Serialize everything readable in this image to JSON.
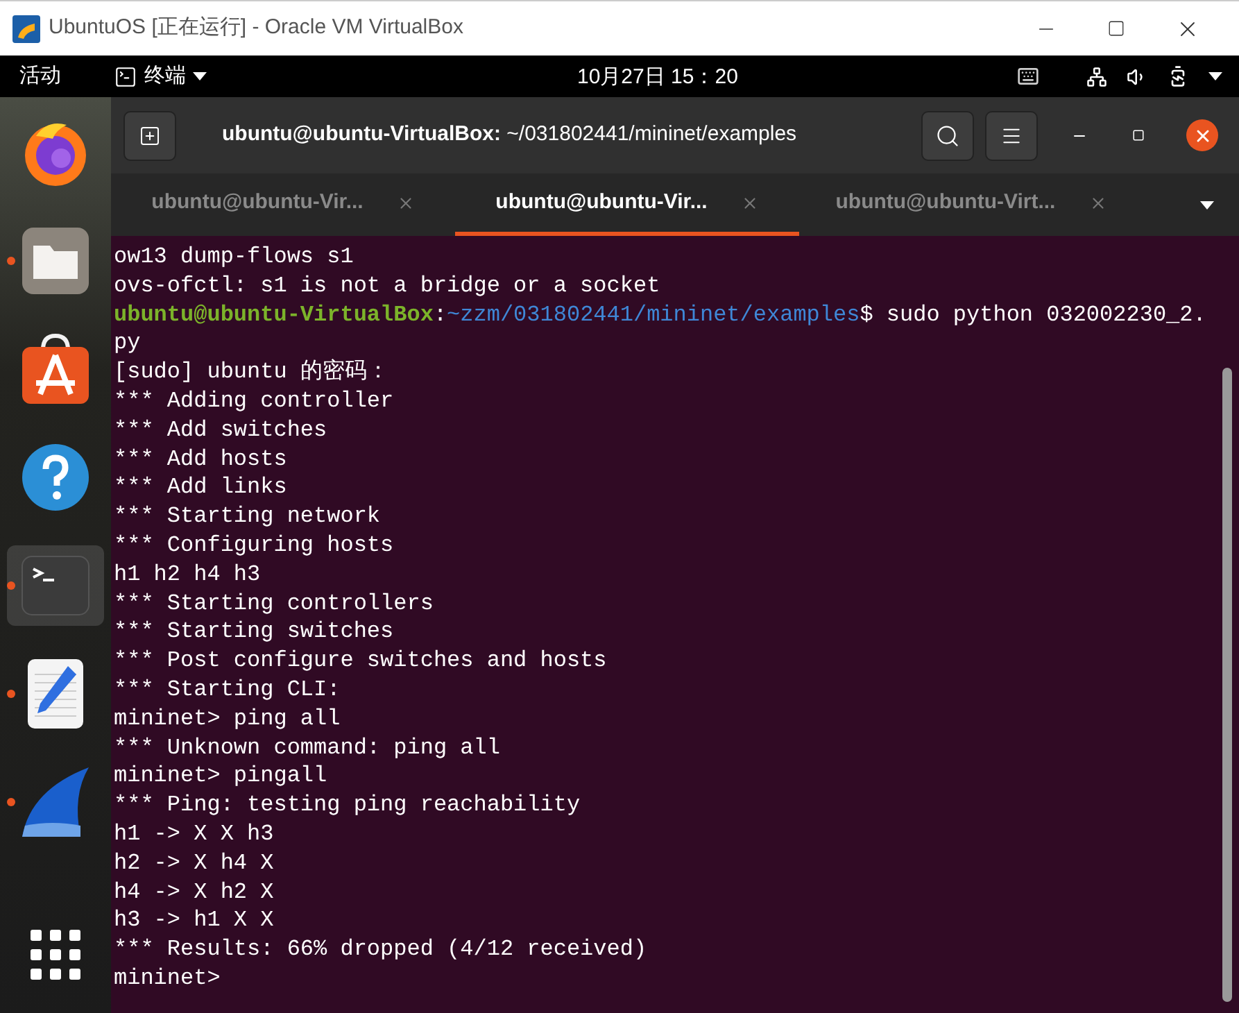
{
  "window": {
    "title": "UbuntuOS [正在运行] - Oracle VM VirtualBox"
  },
  "top_bar": {
    "activities": "活动",
    "app_menu": "终端",
    "clock": "10月27日 15：20"
  },
  "dock": [
    {
      "kind": "firefox",
      "running": false,
      "selected": false
    },
    {
      "kind": "files",
      "running": true,
      "selected": false
    },
    {
      "kind": "software",
      "running": false,
      "selected": false
    },
    {
      "kind": "help",
      "running": false,
      "selected": false
    },
    {
      "kind": "terminal",
      "running": true,
      "selected": true
    },
    {
      "kind": "editor",
      "running": true,
      "selected": false
    },
    {
      "kind": "wireshark",
      "running": true,
      "selected": false
    },
    {
      "kind": "apps",
      "running": false,
      "selected": false
    }
  ],
  "terminal": {
    "title_user": "ubuntu@ubuntu-VirtualBox:",
    "title_path": "~/031802441/mininet/examples",
    "tabs": [
      {
        "label": "ubuntu@ubuntu-Vir...",
        "selected": false
      },
      {
        "label": "ubuntu@ubuntu-Vir...",
        "selected": true
      },
      {
        "label": "ubuntu@ubuntu-Virt...",
        "selected": false
      }
    ],
    "lines": [
      [
        {
          "kind": "plain",
          "text": "ow13 dump-flows s1"
        }
      ],
      [
        {
          "kind": "plain",
          "text": "ovs-ofctl: s1 is not a bridge or a socket"
        }
      ],
      [
        {
          "kind": "user",
          "text": "ubuntu@ubuntu-VirtualBox"
        },
        {
          "kind": "plain",
          "text": ":"
        },
        {
          "kind": "path",
          "text": "~zzm/031802441/mininet/examples"
        },
        {
          "kind": "plain",
          "text": "$ sudo python 032002230_2."
        }
      ],
      [
        {
          "kind": "plain",
          "text": "py"
        }
      ],
      [
        {
          "kind": "plain",
          "text": "[sudo] ubuntu 的密码："
        }
      ],
      [
        {
          "kind": "plain",
          "text": "*** Adding controller"
        }
      ],
      [
        {
          "kind": "plain",
          "text": "*** Add switches"
        }
      ],
      [
        {
          "kind": "plain",
          "text": "*** Add hosts"
        }
      ],
      [
        {
          "kind": "plain",
          "text": "*** Add links"
        }
      ],
      [
        {
          "kind": "plain",
          "text": "*** Starting network"
        }
      ],
      [
        {
          "kind": "plain",
          "text": "*** Configuring hosts"
        }
      ],
      [
        {
          "kind": "plain",
          "text": "h1 h2 h4 h3"
        }
      ],
      [
        {
          "kind": "plain",
          "text": "*** Starting controllers"
        }
      ],
      [
        {
          "kind": "plain",
          "text": "*** Starting switches"
        }
      ],
      [
        {
          "kind": "plain",
          "text": "*** Post configure switches and hosts"
        }
      ],
      [
        {
          "kind": "plain",
          "text": "*** Starting CLI:"
        }
      ],
      [
        {
          "kind": "plain",
          "text": "mininet> ping all"
        }
      ],
      [
        {
          "kind": "plain",
          "text": "*** Unknown command: ping all"
        }
      ],
      [
        {
          "kind": "plain",
          "text": "mininet> pingall"
        }
      ],
      [
        {
          "kind": "plain",
          "text": "*** Ping: testing ping reachability"
        }
      ],
      [
        {
          "kind": "plain",
          "text": "h1 -> X X h3"
        }
      ],
      [
        {
          "kind": "plain",
          "text": "h2 -> X h4 X"
        }
      ],
      [
        {
          "kind": "plain",
          "text": "h4 -> X h2 X"
        }
      ],
      [
        {
          "kind": "plain",
          "text": "h3 -> h1 X X"
        }
      ],
      [
        {
          "kind": "plain",
          "text": "*** Results: 66% dropped (4/12 received)"
        }
      ],
      [
        {
          "kind": "plain",
          "text": "mininet>"
        }
      ]
    ]
  }
}
